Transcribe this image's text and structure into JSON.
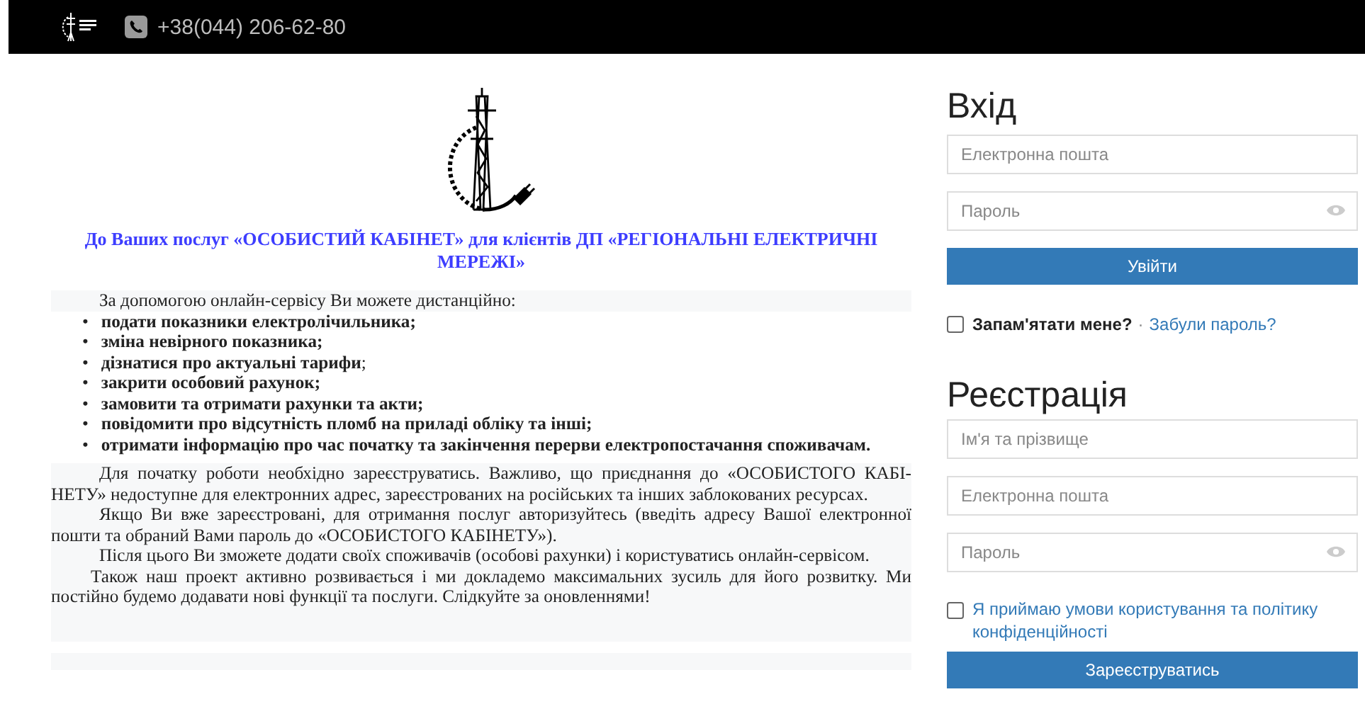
{
  "header": {
    "phone": "+38(044) 206-62-80"
  },
  "intro": {
    "title": "До Ваших послуг «ОСОБИСТИЙ КАБІНЕТ» для клієнтів ДП «РЕГІОНАЛЬНІ ЕЛЕКТРИЧНІ МЕРЕЖІ»",
    "lead": "За допомогою онлайн-сервісу Ви можете дистанційно:",
    "features": [
      {
        "marker": "•",
        "text": "подати показники електролічильника;",
        "bold": true
      },
      {
        "marker": "•",
        "text": "зміна невірного показника;",
        "bold": true
      },
      {
        "marker": "•",
        "text": "**дізнатися про актуальні тарифи**;",
        "bold": false
      },
      {
        "marker": "•",
        "text": "закрити особовий рахунок;",
        "bold": true
      },
      {
        "marker": "•",
        "text": "замовити та отримати рахунки та акти;",
        "bold": true
      },
      {
        "marker": "•",
        "text": "повідомити про відсутність пломб на приладі обліку та інші;",
        "bold": true
      },
      {
        "marker": "•",
        "text": "отримати інформацію про час початку та закінчення перерви електропостачання споживачам.",
        "bold": true
      }
    ],
    "paragraphs": [
      "Для початку роботи необхідно зареєструватись. Важливо, що приєднання до «ОСОБИСТОГО КАБІ-НЕТУ» недоступне для електронних адрес, зареєстрованих на російських та інших  заблокованих ресурсах.",
      "Якщо Ви вже зареєстровані, для отримання послуг авторизуйтесь (введіть адресу Вашої електронної пошти та обраний Вами пароль до «ОСОБИСТОГО КАБІНЕТУ»).",
      "Після цього Ви зможете додати своїх споживачів (особові рахунки) і користуватись онлайн-сервісом.",
      "Також наш проект активно розвивається і ми докладемо максимальних зусиль для його розвитку. Ми постійно будемо додавати нові функції та послуги. Слідкуйте за оновленнями!"
    ]
  },
  "login": {
    "title": "Вхід",
    "email_placeholder": "Електронна пошта",
    "password_placeholder": "Пароль",
    "submit": "Увійти",
    "remember": {
      "label": "Запам'ятати мене?",
      "checked": false
    },
    "separator": "·",
    "forgot": "Забули пароль?"
  },
  "register": {
    "title": "Реєстрація",
    "name_placeholder": "Ім'я та прізвище",
    "email_placeholder": "Електронна пошта",
    "password_placeholder": "Пароль",
    "terms": {
      "label": "Я приймаю умови користування та політику конфіденційності",
      "checked": false
    },
    "submit": "Зареєструватись"
  }
}
